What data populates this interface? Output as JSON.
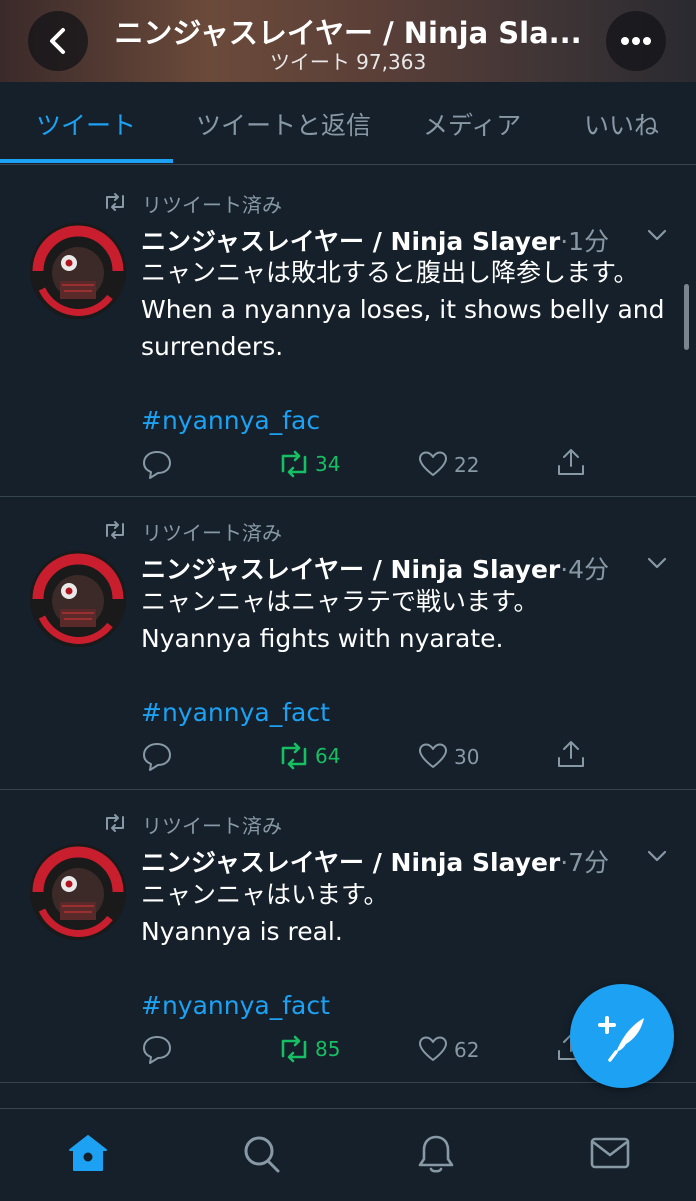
{
  "header": {
    "title": "ニンジャスレイヤー / Ninja Sla...",
    "subtitle": "ツイート 97,363",
    "back_icon": "chevron-left-icon",
    "more_icon": "more-dots-icon"
  },
  "tabs": [
    {
      "label": "ツイート",
      "active": true
    },
    {
      "label": "ツイートと返信",
      "active": false
    },
    {
      "label": "メディア",
      "active": false
    },
    {
      "label": "いいね",
      "active": false
    }
  ],
  "tweets": [
    {
      "retweet_label": "リツイート済み",
      "author": "ニンジャスレイヤー / Ninja Slayer",
      "time": "·1分",
      "text_jp": "ニャンニャは敗北すると腹出し降参します。",
      "text_en": "When a nyannya loses, it shows belly and surrenders.",
      "hashtag": "#nyannya_fac",
      "retweets": "34",
      "likes": "22"
    },
    {
      "retweet_label": "リツイート済み",
      "author": "ニンジャスレイヤー / Ninja Slayer",
      "time": "·4分",
      "text_jp": "ニャンニャはニャラテで戦います。",
      "text_en": "Nyannya fights with nyarate.",
      "hashtag": "#nyannya_fact",
      "retweets": "64",
      "likes": "30"
    },
    {
      "retweet_label": "リツイート済み",
      "author": "ニンジャスレイヤー / Ninja Slayer",
      "time": "·7分",
      "text_jp": "ニャンニャはいます。",
      "text_en": "Nyannya is real.",
      "hashtag": "#nyannya_fact",
      "retweets": "85",
      "likes": "62"
    }
  ],
  "avatar_lettering": "NINJA SLAYER",
  "colors": {
    "background": "#15202b",
    "accent": "#1da1f2",
    "retweet_green": "#17bf63",
    "muted": "#8899a6",
    "divider": "#38444d"
  },
  "bottom_nav": [
    "home-icon",
    "search-icon",
    "bell-icon",
    "mail-icon"
  ],
  "fab_icon": "compose-tweet-icon"
}
